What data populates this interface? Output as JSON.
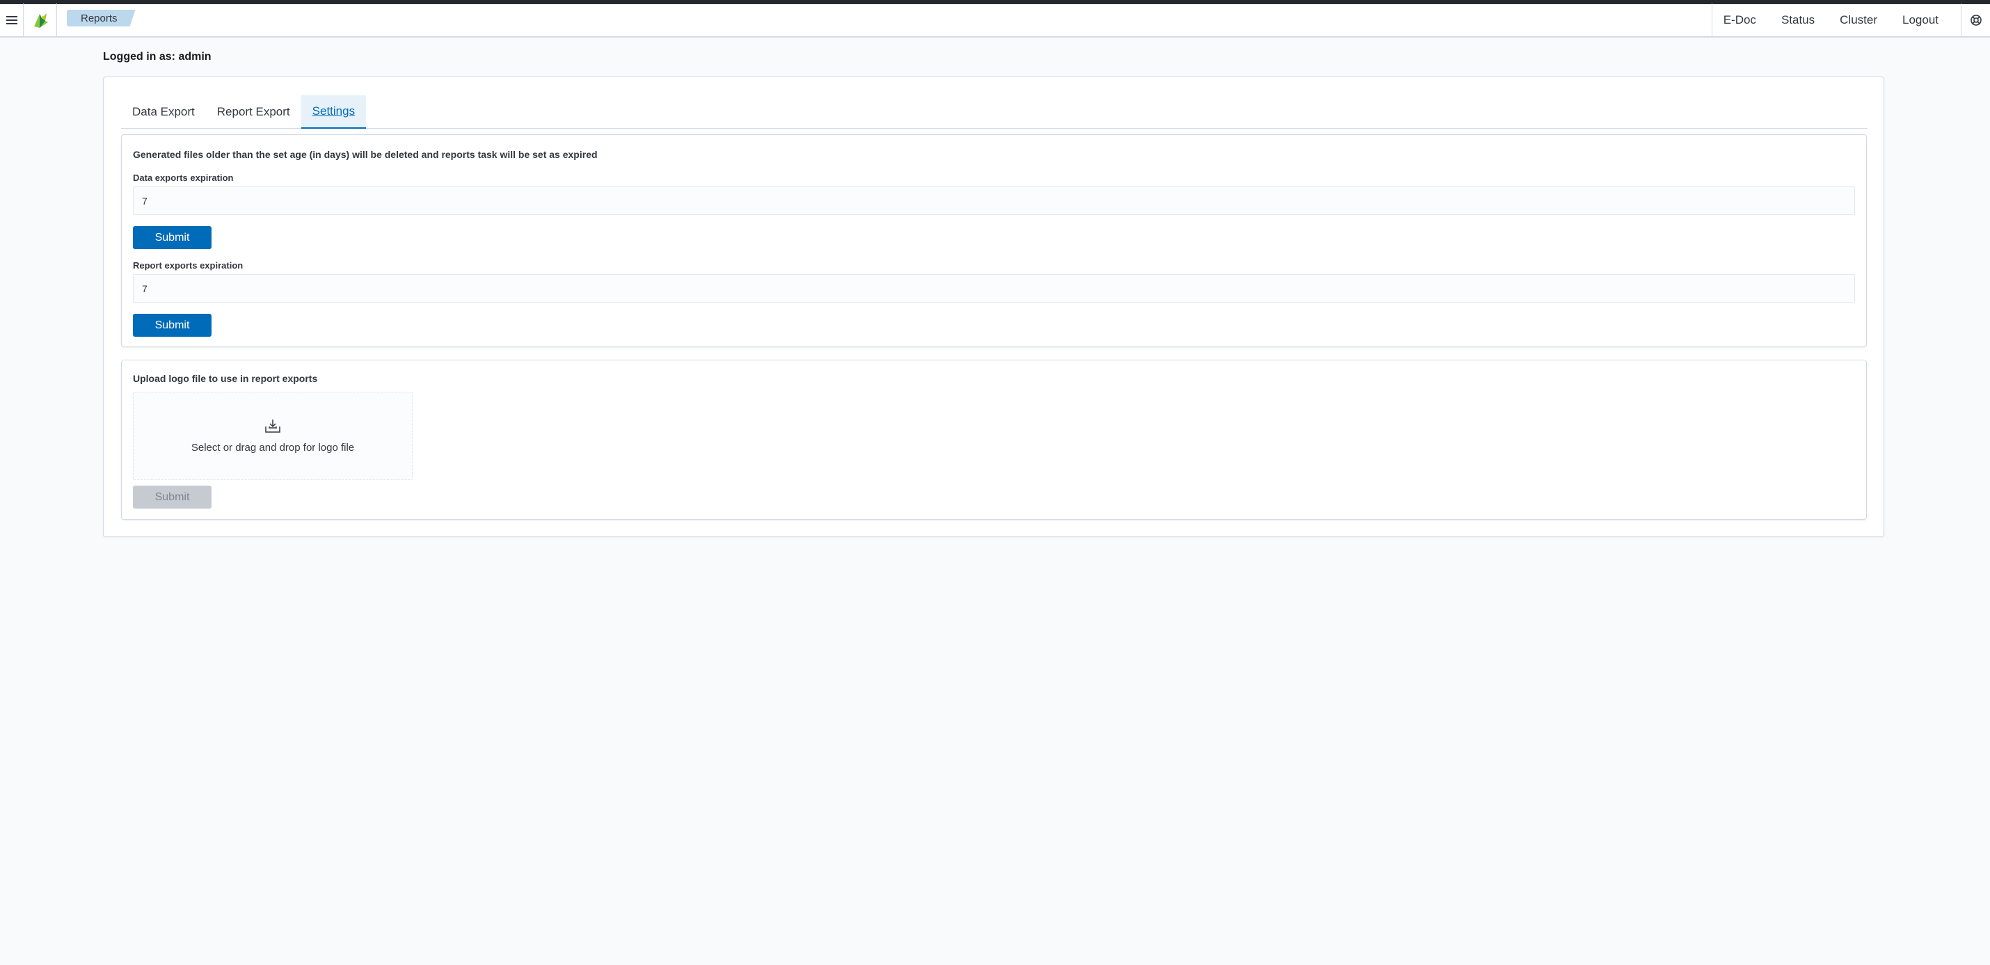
{
  "header": {
    "breadcrumb": "Reports",
    "nav": [
      "E-Doc",
      "Status",
      "Cluster",
      "Logout"
    ]
  },
  "user": {
    "logged_in_text": "Logged in as: admin"
  },
  "tabs": [
    {
      "label": "Data Export"
    },
    {
      "label": "Report Export"
    },
    {
      "label": "Settings",
      "active": true
    }
  ],
  "expiration_settings": {
    "title": "Generated files older than the set age (in days) will be deleted and reports task will be set as expired",
    "data_exports": {
      "label": "Data exports expiration",
      "value": "7",
      "submit_label": "Submit"
    },
    "report_exports": {
      "label": "Report exports expiration",
      "value": "7",
      "submit_label": "Submit"
    }
  },
  "logo_upload": {
    "title": "Upload logo file to use in report exports",
    "dropzone_text": "Select or drag and drop for logo file",
    "submit_label": "Submit"
  },
  "colors": {
    "primary": "#006bb8",
    "active_tab_bg": "#e6f1fa",
    "breadcrumb_bg": "#bcd8ec",
    "disabled_button": "#c6cbd2"
  }
}
